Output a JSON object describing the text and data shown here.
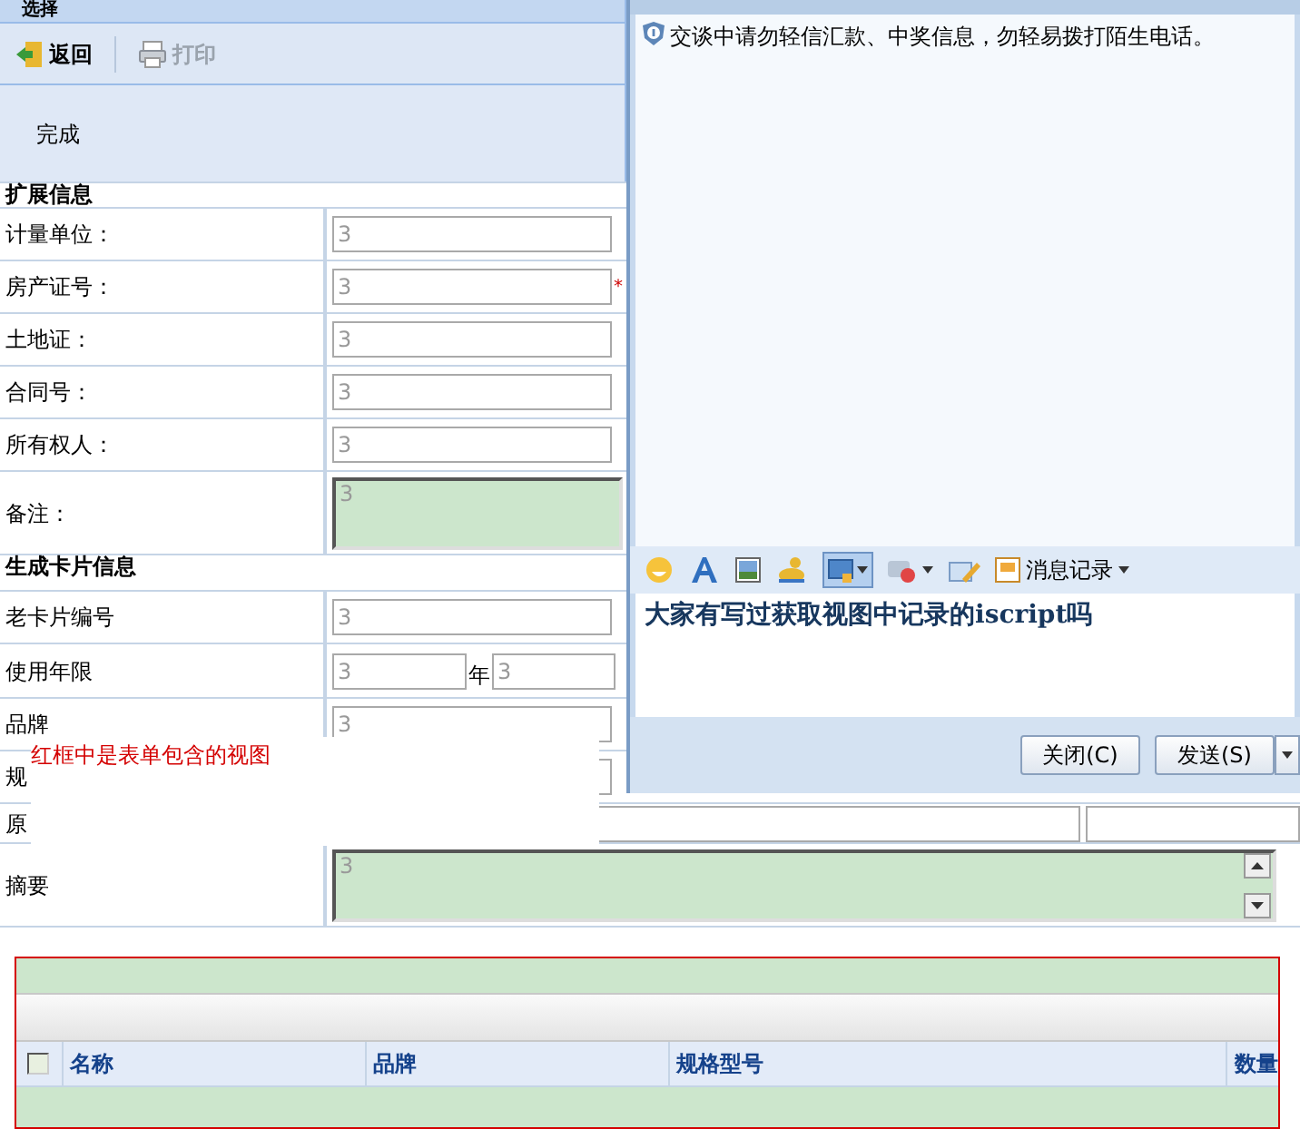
{
  "left_panel": {
    "title": "选择",
    "toolbar": [
      {
        "kind": "back",
        "label": "返回",
        "disabled": false
      },
      {
        "kind": "print",
        "label": "打印",
        "disabled": true
      }
    ],
    "status": "完成"
  },
  "form": [
    {
      "kind": "section",
      "title": "扩展信息"
    },
    {
      "kind": "input",
      "label": "计量单位：",
      "value": "3"
    },
    {
      "kind": "input",
      "label": "房产证号：",
      "value": "3",
      "required_mark": "*"
    },
    {
      "kind": "input",
      "label": "土地证：",
      "value": "3"
    },
    {
      "kind": "input",
      "label": "合同号：",
      "value": "3"
    },
    {
      "kind": "input",
      "label": "所有权人：",
      "value": "3"
    },
    {
      "kind": "textarea",
      "label": "备注：",
      "value": "3"
    },
    {
      "kind": "section",
      "title": "生成卡片信息"
    },
    {
      "kind": "input",
      "label": "老卡片编号",
      "value": "3"
    },
    {
      "kind": "pair",
      "label": "使用年限",
      "value": "3",
      "unit": "年",
      "value_2": "3"
    },
    {
      "kind": "input",
      "label": "品牌",
      "value": "3"
    },
    {
      "kind": "input",
      "label": "规"
    },
    {
      "kind": "wide",
      "label": "原"
    },
    {
      "kind": "wide_textarea",
      "label": "摘要",
      "value": "3"
    }
  ],
  "annotation": "红框中是表单包含的视图",
  "grid": {
    "select_all_checked": false,
    "columns": [
      "名称",
      "品牌",
      "规格型号",
      "数量"
    ]
  },
  "chat": {
    "notice": "交谈中请勿轻信汇款、中奖信息，勿轻易拨打陌生电话。",
    "history_button": "消息记录",
    "message": "大家有写过获取视图中记录的iscript吗",
    "buttons": [
      "关闭(C)",
      "发送(S)"
    ]
  }
}
